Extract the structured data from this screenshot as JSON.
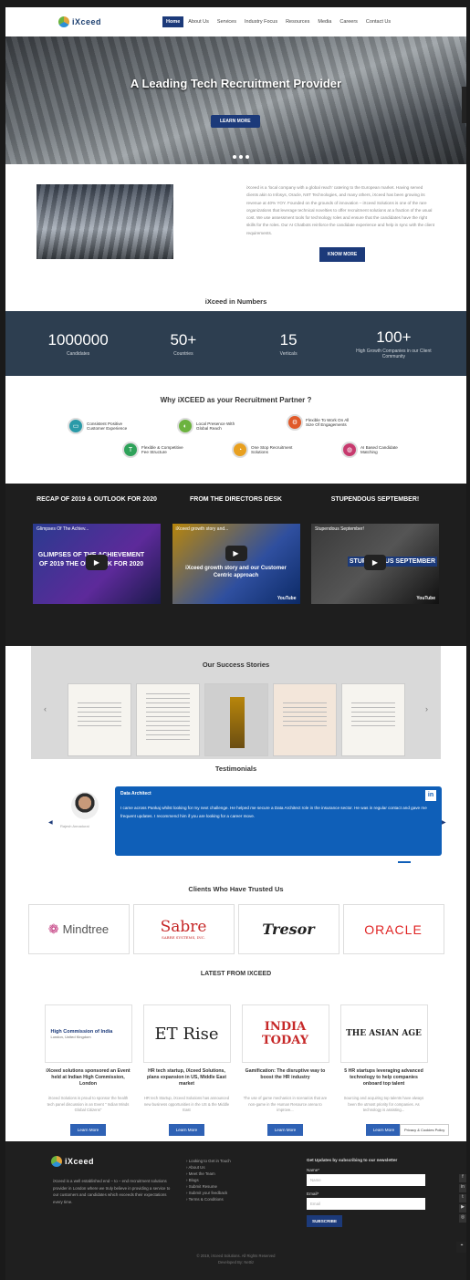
{
  "header": {
    "logo_text": "iXceed",
    "nav": [
      "Home",
      "About Us",
      "Services",
      "Industry Focus",
      "Resources",
      "Media",
      "Careers",
      "Contact Us"
    ]
  },
  "hero": {
    "title": "A Leading Tech Recruitment Provider",
    "button": "LEARN MORE"
  },
  "intro": {
    "text": "iXceed is a 'local company with a global reach' catering to the European market. Having served clients akin to Infosys, Oracle, NIIT Technologies, and many others, iXceed has been growing its revenue at 40% YOY. Founded on the grounds of innovation – iXceed Solutions is one of the rare organizations that leverage technical novelties to offer recruitment solutions at a fraction of the usual cost. We use assessment tools for technology roles and ensure that the candidates have the right skills for the roles. Our AI Chatbots reinforce the candidate experience and help in sync with the client requirements.",
    "button": "KNOW MORE",
    "numbers_title": "iXceed in Numbers"
  },
  "numbers": [
    {
      "value": "1000000",
      "label": "Candidates"
    },
    {
      "value": "50+",
      "label": "Countries"
    },
    {
      "value": "15",
      "label": "Verticals"
    },
    {
      "value": "100+",
      "label": "High Growth Companies in our Client Community"
    }
  ],
  "why": {
    "title": "Why iXCEED as your Recruitment Partner ?",
    "items": [
      "Consistent Positive Customer Experience",
      "Flexible & Competitive Fee Structure",
      "Local Presence With Global Reach",
      "One Stop Recruitment Solutions",
      "Flexible To Work On All Size Of Engagements",
      "AI Based Candidate Matching"
    ]
  },
  "recap": [
    {
      "heading": "RECAP OF 2019 & OUTLOOK FOR 2020",
      "video_title": "Glimpses Of The Achiev...",
      "overlay": "GLIMPSES OF THE ACHIEVEMENT OF 2019 THE OUTLOOK FOR 2020"
    },
    {
      "heading": "FROM THE DIRECTORS DESK",
      "video_title": "iXceed growth story and...",
      "overlay": "iXceed growth story and our Customer Centric approach",
      "yt": "YouTube"
    },
    {
      "heading": "STUPENDOUS SEPTEMBER!",
      "video_title": "Stupendous September!",
      "overlay": "STUPENDOUS SEPTEMBER",
      "yt": "YouTube"
    }
  ],
  "success": {
    "title": "Our Success Stories"
  },
  "testimonials": {
    "title": "Testimonials",
    "name": "Rajesh Annadurai",
    "role": "Data Architect",
    "text": "I came across Pankaj whilst looking for my next challenge. He helped me secure a Data Architect role in the insurance sector. He was in regular contact and gave me frequent updates. I recommend him if you are looking for a career move.",
    "badge": "in"
  },
  "clients": {
    "title": "Clients Who Have Trusted Us",
    "logos": [
      "Mindtree",
      "Sabre",
      "Tresor",
      "ORACLE"
    ],
    "sabre_sub": "SABRE SYSTEMS, INC."
  },
  "latest": {
    "title": "LATEST FROM IXCEED",
    "items": [
      {
        "logo": "High Commission of India",
        "logo_sub": "London, United Kingdom",
        "title": "iXceed solutions sponsored an Event held at Indian High Commission, London",
        "text": "iXceed Solutions is proud to sponsor the health tech panel discussion in an Event \" Indian Minds Global Citizens\"",
        "button": "Learn More"
      },
      {
        "logo": "ET Rise",
        "title": "HR tech startup, iXceed Solutions, plans expansion in US, Middle East market",
        "text": "HR tech Startup, iXceed Solutions has announced new business opportunities in the US & the Middle East",
        "button": "Learn More"
      },
      {
        "logo": "INDIA TODAY",
        "title": "Gamification: The disruptive way to boost the HR industry",
        "text": "The use of game mechanics in scenarios that are non-game in the Human Resource arena to improve...",
        "button": "Learn More"
      },
      {
        "logo": "THE ASIAN AGE",
        "title": "5 HR startups leveraging advanced technology to help companies onboard top talent",
        "text": "Sourcing and acquiring top talents have always been the utmost priority for companies. As technology is assisting...",
        "button": "Learn More"
      }
    ],
    "cookie": "Privacy & Cookies Policy"
  },
  "footer": {
    "about": "iXceed is a well established end – to – end recruitment solutions provider in London where we truly believe in providing a service to our customers and candidates which exceeds their expectations every time.",
    "links": [
      "Looking to Get in Touch",
      "About Us",
      "Meet the Team",
      "Blogs",
      "Submit Resume",
      "Submit your feedback",
      "Terms & Conditions"
    ],
    "newsletter_title": "Get Updates by subscribing to our newsletter",
    "name_label": "Name*",
    "name_ph": "Name",
    "email_label": "Email*",
    "email_ph": "Email",
    "subscribe": "SUBSCRIBE",
    "copyright": "© 2019, iXceed Solutions. All Rights Reserved",
    "dev": "Developed By: Nettiz"
  }
}
